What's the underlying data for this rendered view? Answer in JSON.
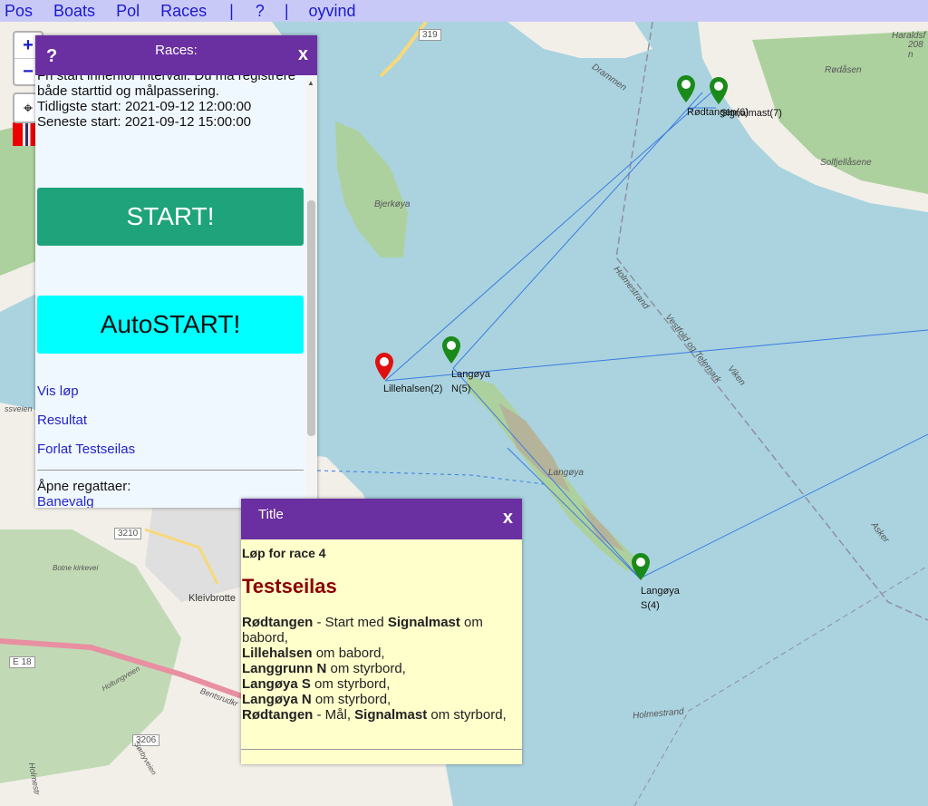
{
  "topbar": {
    "items": [
      "Pos",
      "Boats",
      "Pol",
      "Races"
    ],
    "sep1": "|",
    "help": "?",
    "sep2": "|",
    "user": "oyvind"
  },
  "map_controls": {
    "zoom_in": "+",
    "zoom_out": "−",
    "locate_icon": "crosshair-icon"
  },
  "races_panel": {
    "help": "?",
    "title": "Races:",
    "close": "x",
    "text_lines": [
      "Fri start innenfor intervall. Du må registrere",
      "både starttid og målpassering.",
      "Tidligste start: 2021-09-12 12:00:00",
      "Seneste start: 2021-09-12 15:00:00"
    ],
    "start_button": "START!",
    "autostart_button": "AutoSTART!",
    "links": [
      "Vis løp",
      "Resultat",
      "Forlat Testseilas"
    ],
    "open_regattas_label": "Åpne regattaer:",
    "banevalg_link": "Banevalg"
  },
  "title_panel": {
    "title": "Title",
    "close": "x",
    "race_label": "Løp for race 4",
    "heading": "Testseilas",
    "course": [
      {
        "bold": "Rødtangen",
        "text": " - Start med ",
        "bold2": "Signalmast",
        "text2": " om babord,"
      },
      {
        "bold": "Lillehalsen",
        "text": " om babord,",
        "bold2": "",
        "text2": ""
      },
      {
        "bold": "Langgrunn N",
        "text": " om styrbord,",
        "bold2": "",
        "text2": ""
      },
      {
        "bold": "Langøya S",
        "text": " om styrbord,",
        "bold2": "",
        "text2": ""
      },
      {
        "bold": "Langøya N",
        "text": " om styrbord,",
        "bold2": "",
        "text2": ""
      },
      {
        "bold": "Rødtangen",
        "text": " - Mål, ",
        "bold2": "Signalmast",
        "text2": " om styrbord,"
      }
    ]
  },
  "markers": {
    "rodtangen": "Rødtangen(6)",
    "signalmast": "Signalmast(7)",
    "lillehalsen": "Lillehalsen(2)",
    "langoya_n": [
      "Langøya",
      "N(5)"
    ],
    "langoya_s": [
      "Langøya",
      "S(4)"
    ]
  },
  "map_labels": {
    "bjerkoya": "Bjerkøya",
    "langoya": "Langøya",
    "rodasen": "Rødåsen",
    "solfjellasene": "Solfjellåsene",
    "holmestrand": "Holmestrand",
    "holmestrand2": "Holmestrand",
    "vestfold": "Vestfold og Telemark",
    "viken": "Viken",
    "asker": "Asker",
    "drammen": "Drammen",
    "kleivbrotte": "Kleivbrotte",
    "botne": "Botne kirkevei",
    "haraldsf": "Haraldsf",
    "haraldsf_num": "208 n",
    "road319": "319",
    "road3210": "3210",
    "road3206": "3206",
    "roadE18": "E 18",
    "bentsrud": "Bentsrudkr",
    "holtung": "Holtungveien",
    "sorbyveien": "Sørbyveien",
    "holmestr": "Holmestr",
    "tredevein": "ssveien"
  },
  "colors": {
    "purple_header": "#6a2fa0",
    "start_green": "#1fa37a",
    "autostart_cyan": "#00ffff",
    "marker_green": "#1a8a1a",
    "marker_red": "#e01010",
    "course_line": "#3b7be0",
    "water": "#aad3df",
    "land": "#f2efe9",
    "forest": "#add19e"
  }
}
